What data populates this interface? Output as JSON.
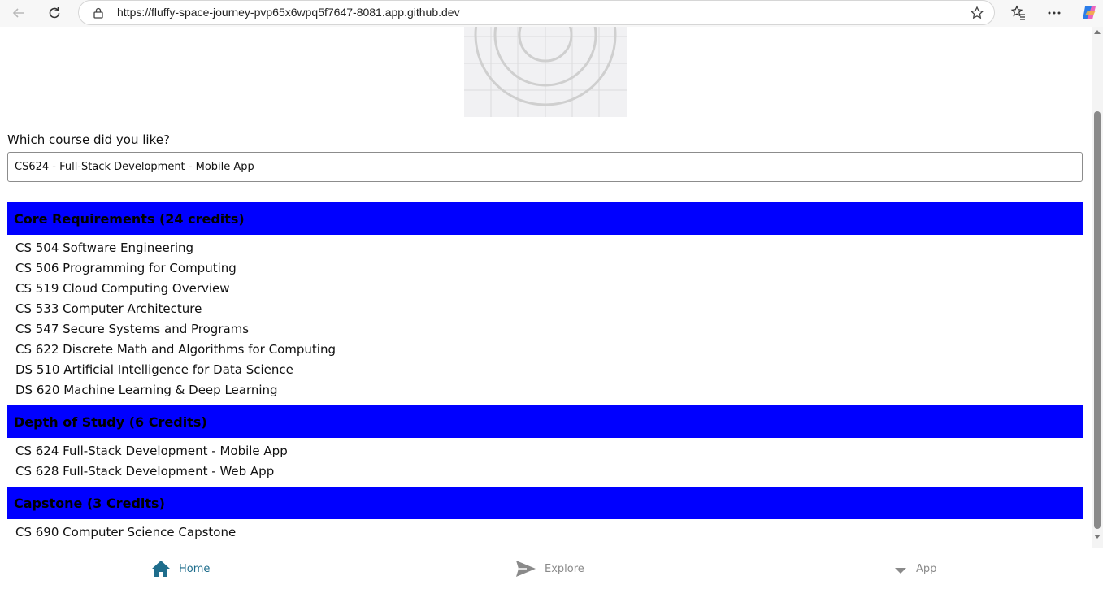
{
  "browser": {
    "url": "https://fluffy-space-journey-pvp65x6wpq5f7647-8081.app.github.dev"
  },
  "form": {
    "question": "Which course did you like?",
    "selected_course": "CS624 - Full-Stack Development - Mobile App"
  },
  "sections": [
    {
      "title": "Core Requirements (24 credits)",
      "courses": [
        "CS 504 Software Engineering",
        "CS 506 Programming for Computing",
        "CS 519 Cloud Computing Overview",
        "CS 533 Computer Architecture",
        "CS 547 Secure Systems and Programs",
        "CS 622 Discrete Math and Algorithms for Computing",
        "DS 510 Artificial Intelligence for Data Science",
        "DS 620 Machine Learning & Deep Learning"
      ]
    },
    {
      "title": "Depth of Study (6 Credits)",
      "courses": [
        "CS 624 Full-Stack Development - Mobile App",
        "CS 628 Full-Stack Development - Web App"
      ]
    },
    {
      "title": "Capstone (3 Credits)",
      "courses": [
        "CS 690 Computer Science Capstone"
      ]
    }
  ],
  "tabs": [
    {
      "label": "Home",
      "icon": "home-icon",
      "active": true
    },
    {
      "label": "Explore",
      "icon": "send-icon",
      "active": false
    },
    {
      "label": "App",
      "icon": "caret-down-icon",
      "active": false
    }
  ],
  "colors": {
    "section_header_bg": "#0000ff",
    "active_tab": "#1e6d8c",
    "inactive_tab": "#8a8a8a"
  }
}
